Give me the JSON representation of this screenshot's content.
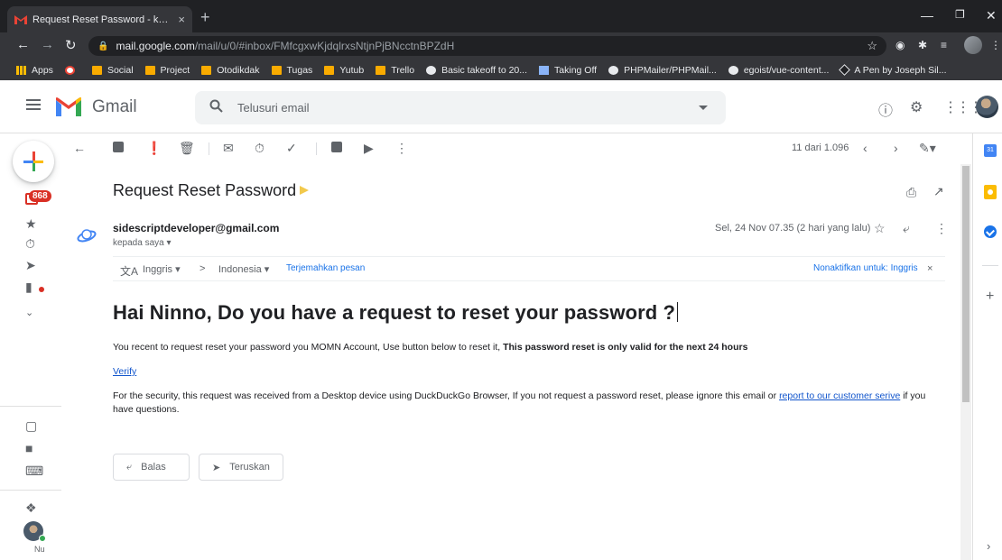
{
  "browser": {
    "tab_title": "Request Reset Password - khusnu",
    "tab_close": "×",
    "new_tab": "+",
    "url_host": "mail.google.com",
    "url_path": "/mail/u/0/#inbox/FMfcgxwKjdqlrxsNtjnPjBNcctnBPZdH",
    "bookmarks": [
      "Apps",
      "Social",
      "Project",
      "Otodikdak",
      "Tugas",
      "Yutub",
      "Trello",
      "Basic takeoff to 20...",
      "Taking Off",
      "PHPMailer/PHPMail...",
      "egoist/vue-content...",
      "A Pen by Joseph Sil..."
    ]
  },
  "gmail": {
    "product_name": "Gmail",
    "search_placeholder": "Telusuri email",
    "unread_badge": "868",
    "pager": "11 dari 1.096",
    "hangouts_label": "Nu"
  },
  "message": {
    "subject": "Request Reset Password",
    "sender_email": "sidescriptdeveloper@gmail.com",
    "to_label": "kepada saya ▾",
    "date": "Sel, 24 Nov 07.35 (2 hari yang lalu)",
    "translate": {
      "from_lang": "Inggris",
      "arrow": ">",
      "to_lang": "Indonesia",
      "translate_link": "Terjemahkan pesan",
      "disable_link": "Nonaktifkan untuk: Inggris",
      "close": "×"
    },
    "heading": "Hai Ninno, Do you have a request to reset your password ?",
    "body_line1_plain": "You recent to request reset your password you MOMN Account, Use button below to reset it, ",
    "body_line1_bold": "This password reset is only valid for the next 24 hours",
    "verify_link": "Verify",
    "body_line2_before": "For the security, this request was received from a Desktop device using DuckDuckGo Browser, If you not request a password reset, please ignore this email or ",
    "body_line2_link": "report to our customer serive",
    "body_line2_after": " if you have questions.",
    "reply_label": "Balas",
    "forward_label": "Teruskan"
  },
  "colors": {
    "badge": "#d93025",
    "link": "#1155cc",
    "important_marker": "#f2c94c"
  }
}
